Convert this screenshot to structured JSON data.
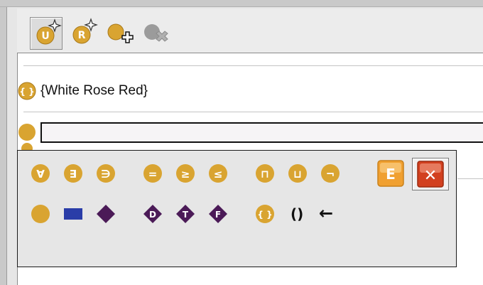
{
  "toolbar": {
    "buttons": [
      {
        "name": "new-union-concept-button",
        "label": "U"
      },
      {
        "name": "new-role-concept-button",
        "label": "R"
      },
      {
        "name": "add-concept-button"
      },
      {
        "name": "delete-concept-button"
      }
    ]
  },
  "concept": {
    "label": "{White Rose Red}",
    "icon_text": "{ }"
  },
  "editor": {
    "value": ""
  },
  "palette": {
    "row1": [
      {
        "name": "forall-symbol-button",
        "glyph": "∀"
      },
      {
        "name": "exists-symbol-button",
        "glyph": "∃"
      },
      {
        "name": "has-value-symbol-button",
        "glyph": "∋"
      },
      {
        "name": "exactly-symbol-button",
        "glyph": "="
      },
      {
        "name": "min-cardinality-symbol-button",
        "glyph": "≥"
      },
      {
        "name": "max-cardinality-symbol-button",
        "glyph": "≤"
      },
      {
        "name": "intersection-symbol-button",
        "glyph": "⊓"
      },
      {
        "name": "union-symbol-button",
        "glyph": "⊔"
      },
      {
        "name": "negation-symbol-button",
        "glyph": "¬"
      }
    ],
    "row2": [
      {
        "name": "class-symbol-button"
      },
      {
        "name": "object-property-symbol-button"
      },
      {
        "name": "data-property-symbol-button"
      },
      {
        "name": "datatype-symbol-button",
        "glyph": "D"
      },
      {
        "name": "true-symbol-button",
        "glyph": "T"
      },
      {
        "name": "false-symbol-button",
        "glyph": "F"
      },
      {
        "name": "enumeration-symbol-button",
        "glyph": "{ }"
      }
    ],
    "parens": "()",
    "arrow": "←",
    "e_button": "E",
    "close_button": "✕"
  },
  "colors": {
    "gold": "#d9a431",
    "gold_dark": "#a8791a",
    "purple": "#4b1a57",
    "blue": "#2a3da8",
    "gray_icon": "#8e8e8e",
    "e_orange": "#f0a030",
    "close_red": "#d2401f"
  }
}
